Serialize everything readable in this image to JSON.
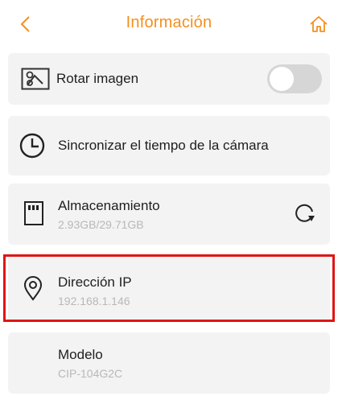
{
  "header": {
    "title": "Información",
    "back_icon": "chevron-left-icon",
    "home_icon": "home-icon",
    "accent_color": "#f39020"
  },
  "rotate": {
    "label": "Rotar imagen",
    "icon": "rotate-image-icon",
    "toggle_on": false
  },
  "sync": {
    "label": "Sincronizar el tiempo de la cámara",
    "icon": "clock-icon"
  },
  "storage": {
    "label": "Almacenamiento",
    "value": "2.93GB/29.71GB",
    "icon": "sd-card-icon",
    "action_icon": "refresh-icon"
  },
  "ip": {
    "label": "Dirección IP",
    "value": "192.168.1.146",
    "icon": "location-pin-icon",
    "highlighted": true,
    "highlight_color": "#e01515"
  },
  "model": {
    "label": "Modelo",
    "value": "CIP-104G2C"
  }
}
